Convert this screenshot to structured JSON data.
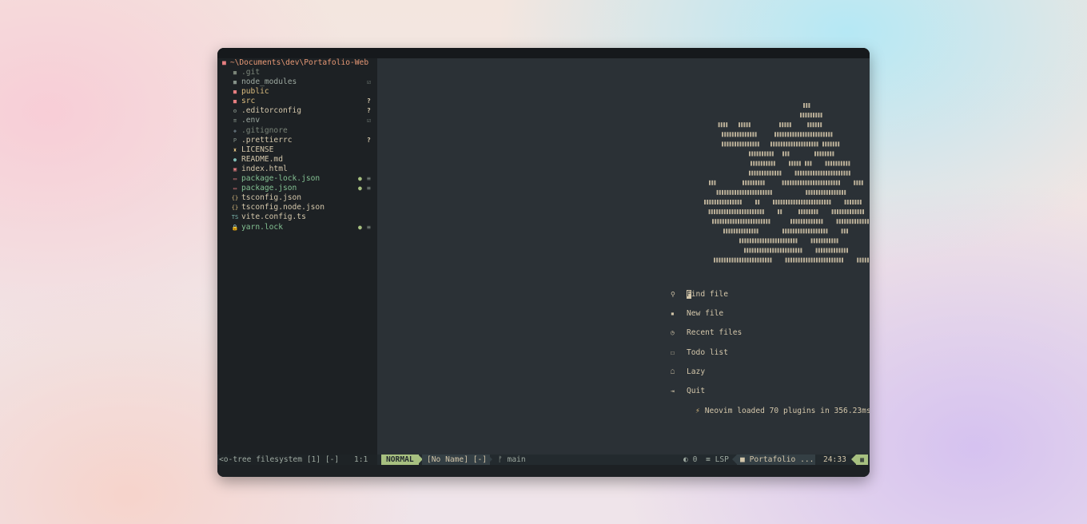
{
  "tree": {
    "root": "~\\Documents\\dev\\Portafolio-Web",
    "items": [
      {
        "name": ".git",
        "icon": "folder-icon",
        "glyph": "■",
        "icon_color": "#7a8478",
        "color": "#7a8478",
        "status": "",
        "status2": ""
      },
      {
        "name": "node_modules",
        "icon": "folder-icon",
        "glyph": "■",
        "icon_color": "#859289",
        "color": "#9da9a0",
        "status": "",
        "status2": "☑"
      },
      {
        "name": "public",
        "icon": "folder-icon",
        "glyph": "■",
        "icon_color": "#e67e80",
        "color": "#dbbc7f",
        "status": "",
        "status2": ""
      },
      {
        "name": "src",
        "icon": "folder-icon",
        "glyph": "■",
        "icon_color": "#e67e80",
        "color": "#dbbc7f",
        "status": "",
        "status2": "?"
      },
      {
        "name": ".editorconfig",
        "icon": "gear-icon",
        "glyph": "⚙",
        "icon_color": "#859289",
        "color": "#d3c6aa",
        "status": "",
        "status2": "?"
      },
      {
        "name": ".env",
        "icon": "settings-file-icon",
        "glyph": "≡",
        "icon_color": "#859289",
        "color": "#9da9a0",
        "status": "",
        "status2": "☑"
      },
      {
        "name": ".gitignore",
        "icon": "git-icon",
        "glyph": "◆",
        "icon_color": "#5c6a72",
        "color": "#7a8478",
        "status": "",
        "status2": ""
      },
      {
        "name": ".prettierrc",
        "icon": "prettier-icon",
        "glyph": "P",
        "icon_color": "#859289",
        "color": "#d3c6aa",
        "status": "",
        "status2": "?"
      },
      {
        "name": "LICENSE",
        "icon": "license-icon",
        "glyph": "♜",
        "icon_color": "#dbbc7f",
        "color": "#d3c6aa",
        "status": "",
        "status2": ""
      },
      {
        "name": "README.md",
        "icon": "info-icon",
        "glyph": "●",
        "icon_color": "#7fbbb3",
        "color": "#d3c6aa",
        "status": "",
        "status2": ""
      },
      {
        "name": "index.html",
        "icon": "html-icon",
        "glyph": "▣",
        "icon_color": "#e67e80",
        "color": "#d3c6aa",
        "status": "",
        "status2": ""
      },
      {
        "name": "package-lock.json",
        "icon": "npm-icon",
        "glyph": "▭",
        "icon_color": "#e67e80",
        "color": "#83c092",
        "status": "●",
        "status2": "≡"
      },
      {
        "name": "package.json",
        "icon": "npm-icon",
        "glyph": "▭",
        "icon_color": "#e67e80",
        "color": "#83c092",
        "status": "●",
        "status2": "≡"
      },
      {
        "name": "tsconfig.json",
        "icon": "json-icon",
        "glyph": "{}",
        "icon_color": "#dbbc7f",
        "color": "#d3c6aa",
        "status": "",
        "status2": ""
      },
      {
        "name": "tsconfig.node.json",
        "icon": "json-icon",
        "glyph": "{}",
        "icon_color": "#dbbc7f",
        "color": "#d3c6aa",
        "status": "",
        "status2": ""
      },
      {
        "name": "vite.config.ts",
        "icon": "typescript-icon",
        "glyph": "TS",
        "icon_color": "#7fbbb3",
        "color": "#d3c6aa",
        "status": "",
        "status2": ""
      },
      {
        "name": "yarn.lock",
        "icon": "lock-icon",
        "glyph": "🔒",
        "icon_color": "#d3c6aa",
        "color": "#83c092",
        "status": "●",
        "status2": "≡"
      }
    ]
  },
  "dashboard": {
    "items": [
      {
        "icon": "search-icon",
        "glyph": "⚲",
        "first": "F",
        "rest": "ind file",
        "key": "f",
        "cursor": true
      },
      {
        "icon": "new-file-icon",
        "glyph": "▪",
        "first": "",
        "rest": "New file",
        "key": "n",
        "cursor": false
      },
      {
        "icon": "recent-files-icon",
        "glyph": "◷",
        "first": "",
        "rest": "Recent files",
        "key": "r",
        "cursor": false
      },
      {
        "icon": "todo-list-icon",
        "glyph": "☐",
        "first": "",
        "rest": "Todo list",
        "key": "g",
        "cursor": false
      },
      {
        "icon": "lazy-icon",
        "glyph": "☖",
        "first": "",
        "rest": "Lazy",
        "key": "l",
        "cursor": false
      },
      {
        "icon": "quit-icon",
        "glyph": "⇥",
        "first": "",
        "rest": "Quit",
        "key": "q",
        "cursor": false
      }
    ],
    "footer": "Neovim loaded 70 plugins in 356.23ms"
  },
  "statusline": {
    "left": "<o-tree filesystem [1] [-]",
    "left_pos": "1:1",
    "mode": "NORMAL",
    "file": "[No Name] [-]",
    "branch": "main",
    "diagnostics": "0",
    "lsp": "LSP",
    "project": "Portafolio ...",
    "clock": "24:33"
  },
  "colors": {
    "accent": "#a7c080",
    "background": "#2b3136",
    "sidebar_bg": "#1d2124",
    "text": "#d3c6aa"
  }
}
